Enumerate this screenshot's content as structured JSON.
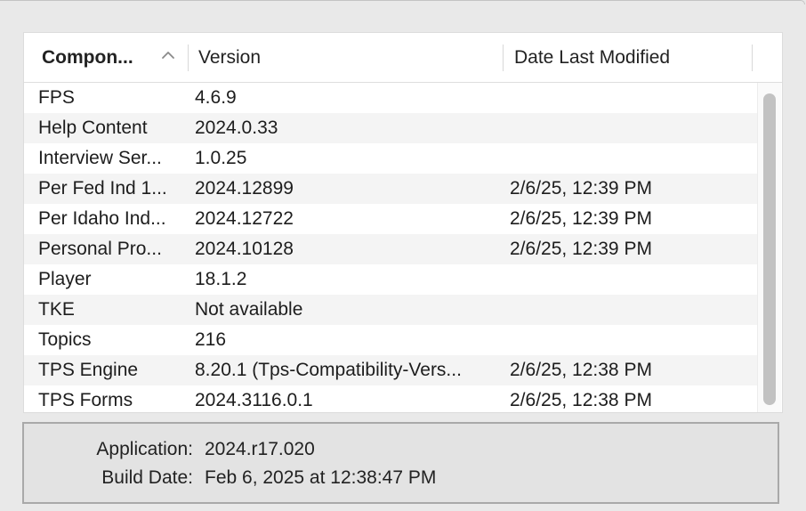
{
  "table": {
    "columns": [
      {
        "label": "Compon...",
        "sorted": "ascending"
      },
      {
        "label": "Version"
      },
      {
        "label": "Date Last Modified"
      }
    ],
    "rows": [
      [
        "FPS",
        "4.6.9",
        ""
      ],
      [
        "Help Content",
        "2024.0.33",
        ""
      ],
      [
        "Interview Ser...",
        "1.0.25",
        ""
      ],
      [
        "Per Fed Ind 1...",
        "2024.12899",
        "2/6/25, 12:39 PM"
      ],
      [
        "Per Idaho Ind...",
        "2024.12722",
        "2/6/25, 12:39 PM"
      ],
      [
        "Personal Pro...",
        "2024.10128",
        "2/6/25, 12:39 PM"
      ],
      [
        "Player",
        "18.1.2",
        ""
      ],
      [
        "TKE",
        "Not available",
        ""
      ],
      [
        "Topics",
        "216",
        ""
      ],
      [
        "TPS Engine",
        "8.20.1 (Tps-Compatibility-Vers...",
        "2/6/25, 12:38 PM"
      ],
      [
        "TPS Forms",
        "2024.3116.0.1",
        "2/6/25, 12:38 PM"
      ]
    ]
  },
  "info": {
    "application_label": "Application:",
    "application_value": "2024.r17.020",
    "build_date_label": "Build Date:",
    "build_date_value": "Feb 6, 2025 at 12:38:47 PM"
  },
  "icons": {
    "sort": "chevron-up-icon"
  }
}
